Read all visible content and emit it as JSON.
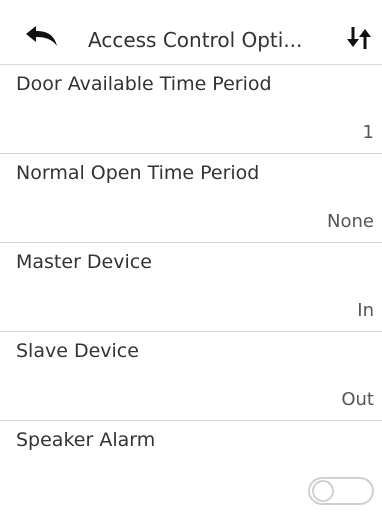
{
  "header": {
    "title": "Access Control Opti..."
  },
  "rows": [
    {
      "label": "Door Available Time Period",
      "value": "1"
    },
    {
      "label": "Normal Open Time Period",
      "value": "None"
    },
    {
      "label": "Master Device",
      "value": "In"
    },
    {
      "label": "Slave Device",
      "value": "Out"
    },
    {
      "label": "Speaker Alarm",
      "toggle_state": "off"
    }
  ],
  "icons": {
    "back": "back-arrow-icon",
    "sort": "sort-icon"
  },
  "colors": {
    "text": "#333333",
    "divider": "#d6d6d6",
    "toggle_off": "#d0d0d0"
  }
}
